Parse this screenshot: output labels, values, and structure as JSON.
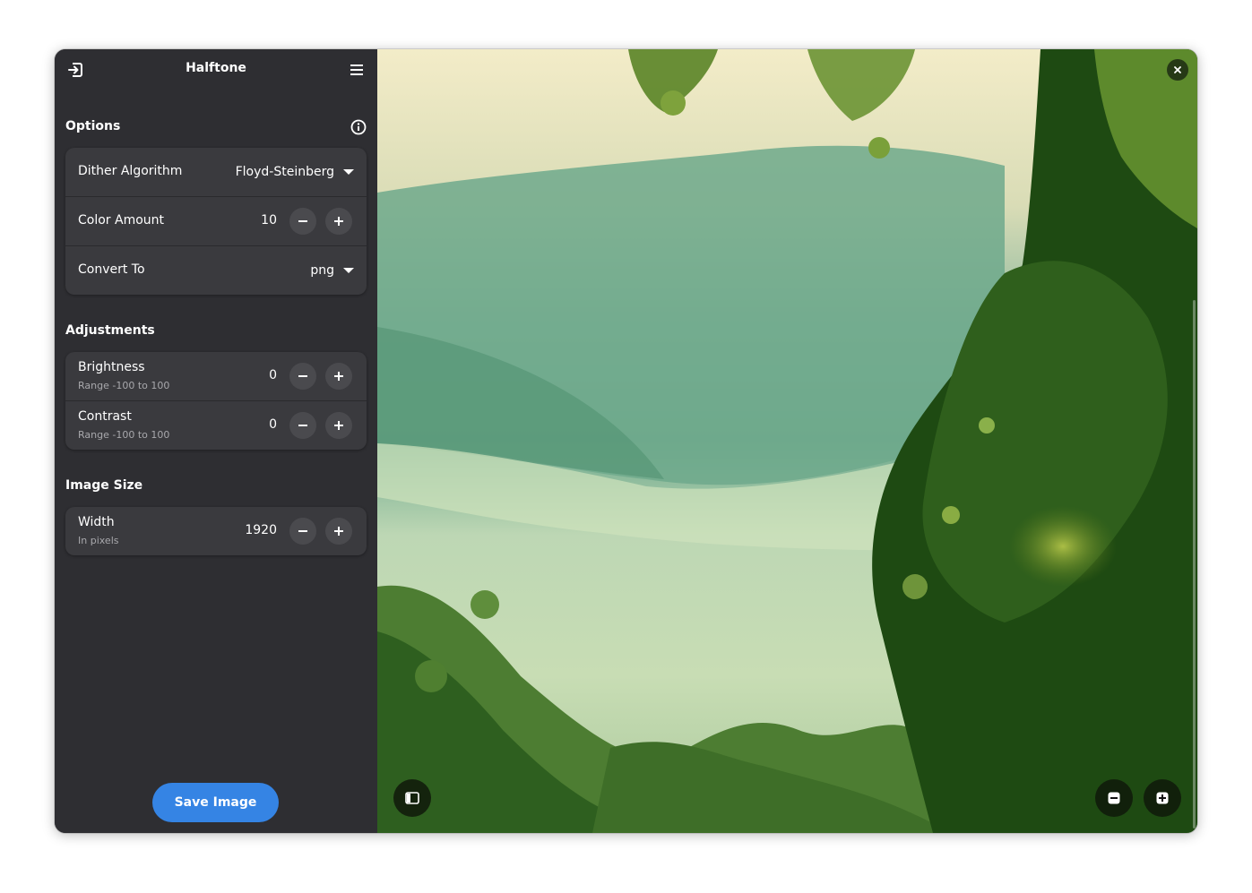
{
  "header": {
    "title": "Halftone",
    "open_icon": "open-image-icon",
    "menu_icon": "hamburger-menu-icon"
  },
  "options": {
    "title": "Options",
    "info_icon": "info-icon",
    "dither": {
      "label": "Dither Algorithm",
      "value": "Floyd-Steinberg"
    },
    "color_amount": {
      "label": "Color Amount",
      "value": "10"
    },
    "convert_to": {
      "label": "Convert To",
      "value": "png"
    }
  },
  "adjustments": {
    "title": "Adjustments",
    "brightness": {
      "label": "Brightness",
      "subtitle": "Range -100 to 100",
      "value": "0"
    },
    "contrast": {
      "label": "Contrast",
      "subtitle": "Range -100 to 100",
      "value": "0"
    }
  },
  "image_size": {
    "title": "Image Size",
    "width": {
      "label": "Width",
      "subtitle": "In pixels",
      "value": "1920"
    }
  },
  "save_label": "Save Image",
  "viewer": {
    "sidebar_toggle_icon": "sidebar-toggle-icon",
    "zoom_out_icon": "zoom-out-icon",
    "zoom_in_icon": "zoom-in-icon",
    "close_icon": "close-icon"
  },
  "colors": {
    "sidebar_bg": "#2e2e32",
    "row_bg": "#3a3a3e",
    "accent": "#3584e4"
  }
}
